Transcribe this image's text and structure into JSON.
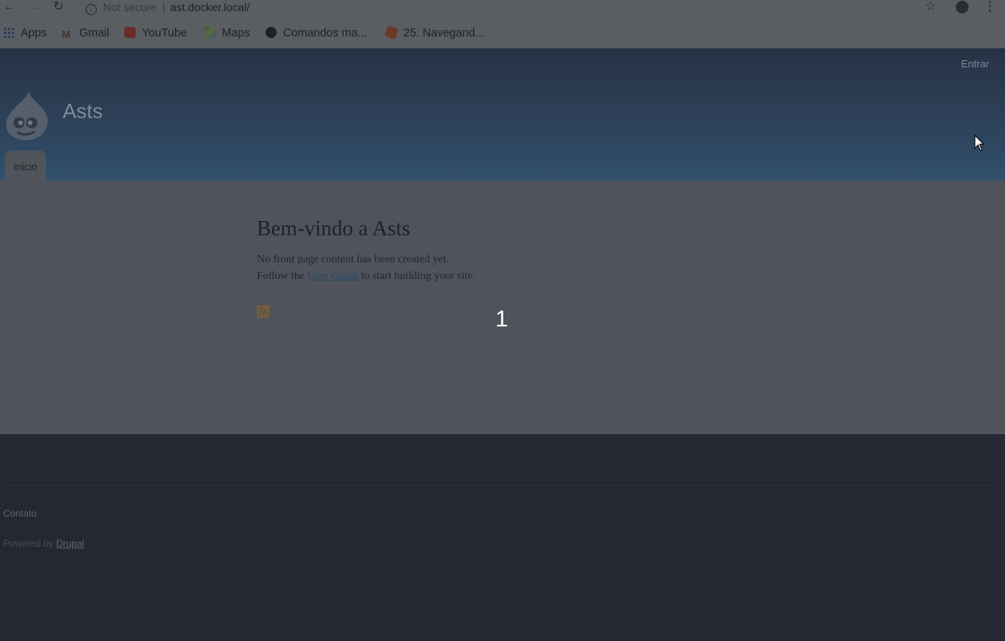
{
  "browser": {
    "url_security": "Not secure",
    "url_host": "ast.docker.local/",
    "bookmarks": [
      {
        "label": "Apps",
        "icon": "apps-grid-icon"
      },
      {
        "label": "Gmail",
        "icon": "gmail-icon"
      },
      {
        "label": "YouTube",
        "icon": "youtube-icon"
      },
      {
        "label": "Maps",
        "icon": "maps-icon"
      },
      {
        "label": "Comandos ma...",
        "icon": "github-icon"
      },
      {
        "label": "25. Navegand...",
        "icon": "bookmark-favicon-icon"
      }
    ]
  },
  "header": {
    "login_link": "Entrar",
    "site_name": "Asts",
    "tabs": [
      {
        "label": "Inicio"
      }
    ]
  },
  "main": {
    "title": "Bem-vindo a Asts",
    "line1": "No front page content has been created yet.",
    "line2_prefix": "Follow the",
    "line2_link": "User Guide",
    "line2_suffix": "to start building your site.",
    "overlay_number": "1"
  },
  "footer": {
    "contact_link": "Contato",
    "powered_prefix": "Powered by",
    "powered_link": "Drupal"
  }
}
